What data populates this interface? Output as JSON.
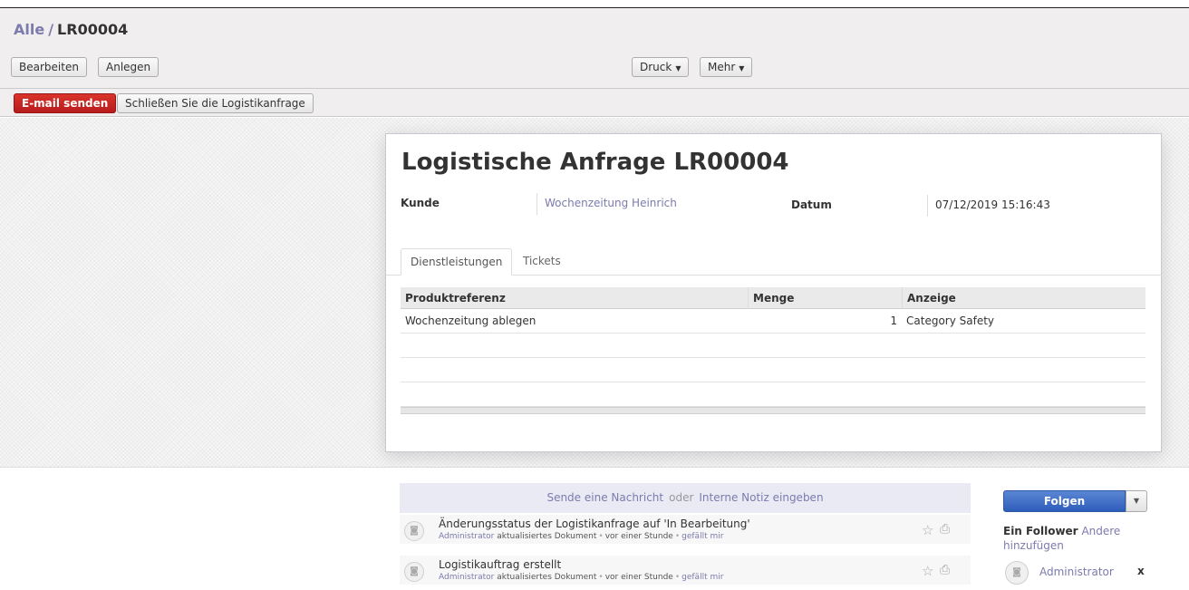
{
  "breadcrumb": {
    "root": "Alle",
    "separator": "/",
    "current": "LR00004"
  },
  "toolbar": {
    "edit": "Bearbeiten",
    "create": "Anlegen",
    "print": "Druck",
    "more": "Mehr"
  },
  "statusbar": {
    "send_email": "E-mail senden",
    "close_request": "Schließen Sie die Logistikanfrage"
  },
  "form": {
    "title": "Logistische Anfrage LR00004",
    "customer_label": "Kunde",
    "customer_value": "Wochenzeitung Heinrich",
    "date_label": "Datum",
    "date_value": "07/12/2019 15:16:43",
    "tabs": [
      "Dienstleistungen",
      "Tickets"
    ],
    "columns": [
      "Produktreferenz",
      "Menge",
      "Anzeige"
    ],
    "rows": [
      {
        "product": "Wochenzeitung ablegen",
        "qty": "1",
        "display": "Category Safety"
      }
    ]
  },
  "chatter": {
    "send_message": "Sende eine Nachricht",
    "or": "oder",
    "internal_note": "Interne Notiz eingeben",
    "messages": [
      {
        "subject": "Änderungsstatus der Logistikanfrage auf 'In Bearbeitung'",
        "author": "Administrator",
        "action": "aktualisiertes Dokument",
        "time": "vor einer Stunde",
        "like": "gefällt mir"
      },
      {
        "subject": "Logistikauftrag erstellt",
        "author": "Administrator",
        "action": "aktualisiertes Dokument",
        "time": "vor einer Stunde",
        "like": "gefällt mir"
      }
    ]
  },
  "followers": {
    "follow_button": "Folgen",
    "count_label": "Ein Follower",
    "add_others": "Andere hinzufügen",
    "list": [
      {
        "name": "Administrator",
        "remove": "x"
      }
    ]
  },
  "colors": {
    "link": "#7c7bad",
    "primary": "#3b6ac6",
    "danger": "#c9302c"
  }
}
